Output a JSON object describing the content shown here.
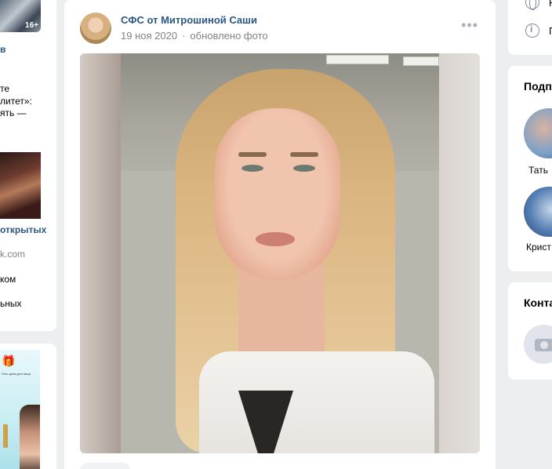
{
  "left_ads": {
    "age_badge": "16+",
    "line_v": "в",
    "line_te": "те",
    "line_litet": "литет»:",
    "line_yat": "ять —",
    "open_link": "открытых",
    "domain": "k.com",
    "line_kom": "ком",
    "line_nykh": "ьных",
    "ad_small_text": "Гель-крем для лица",
    "icons": [
      "gift-icon",
      "person-icon"
    ]
  },
  "post": {
    "author": "СФС от Митрошиной Саши",
    "date": "19 ноя 2020",
    "action": "обновлено фото",
    "more_icon": "more-dots-icon"
  },
  "right": {
    "items": [
      {
        "label": "Н",
        "icon": "globe-icon"
      },
      {
        "label": "Пр",
        "icon": "info-icon"
      }
    ],
    "subscribers_title": "Подп",
    "subscribers": [
      {
        "name": "Тать"
      },
      {
        "name": "Крист"
      }
    ],
    "contacts_title": "Конта"
  },
  "colors": {
    "link": "#2a5885",
    "muted": "#828282",
    "background": "#edeef0"
  }
}
